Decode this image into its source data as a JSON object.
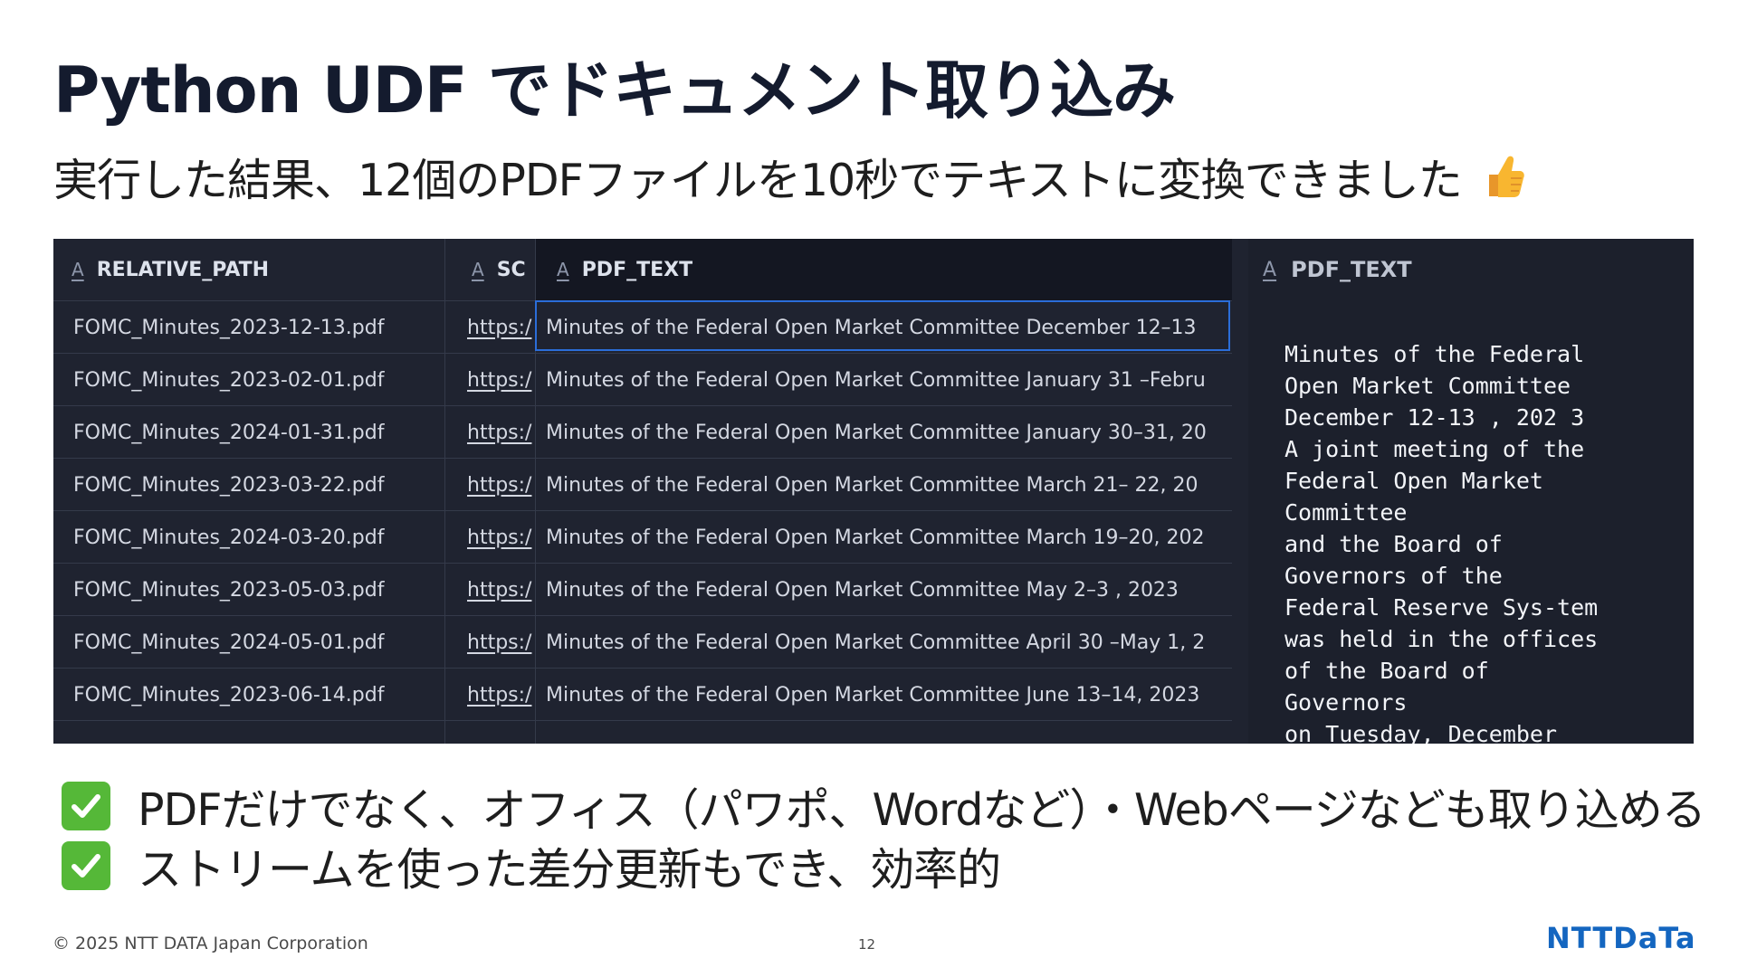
{
  "slide": {
    "title": "Python UDF でドキュメント取り込み",
    "subtitle": "実行した結果、12個のPDFファイルを10秒でテキストに変換できました"
  },
  "grid": {
    "columns": [
      {
        "label": "RELATIVE_PATH",
        "type_icon": "A"
      },
      {
        "label": "SC",
        "type_icon": "A"
      },
      {
        "label": "PDF_TEXT",
        "type_icon": "A"
      }
    ],
    "rows": [
      {
        "path": "FOMC_Minutes_2023-12-13.pdf",
        "url": "https:/",
        "text": " Minutes of the Federal Open Market Committee  December 12–13"
      },
      {
        "path": "FOMC_Minutes_2023-02-01.pdf",
        "url": "https:/",
        "text": "Minutes of the Federal Open Market Committee  January 31 –Febru"
      },
      {
        "path": "FOMC_Minutes_2024-01-31.pdf",
        "url": "https:/",
        "text": "Minutes of the Federal Open Market Committee  January  30–31, 20"
      },
      {
        "path": "FOMC_Minutes_2023-03-22.pdf",
        "url": "https:/",
        "text": " Minutes of the Federal Open Market Committee  March 21– 22, 20"
      },
      {
        "path": "FOMC_Minutes_2024-03-20.pdf",
        "url": "https:/",
        "text": "Minutes of the Federal Open Market Committee  March 19–20, 202"
      },
      {
        "path": "FOMC_Minutes_2023-05-03.pdf",
        "url": "https:/",
        "text": "Minutes of the Federal Open Market Committee   May 2–3 , 2023"
      },
      {
        "path": "FOMC_Minutes_2024-05-01.pdf",
        "url": "https:/",
        "text": "Minutes of the Federal Open Market Committee   April 30 –May 1, 2"
      },
      {
        "path": "FOMC_Minutes_2023-06-14.pdf",
        "url": "https:/",
        "text": " Minutes of the Federal Open Market Committee  June 13–14, 2023"
      }
    ]
  },
  "detail": {
    "header": "PDF_TEXT",
    "type_icon": "A",
    "text": "Minutes of the Federal\nOpen Market Committee\nDecember 12-13 , 202 3\nA joint meeting of the\nFederal Open Market\nCommittee\nand the Board of\nGovernors of the\nFederal Reserve Sys-tem\nwas held in the offices\nof the Board of\nGovernors\non Tuesday, December"
  },
  "bullets": [
    "PDFだけでなく、オフィス（パワポ、Wordなど）・Webページなども取り込める",
    "ストリームを使った差分更新もでき、効率的"
  ],
  "footer": {
    "copyright": "© 2025 NTT DATA Japan Corporation",
    "page_number": "12",
    "logo": "NTTDaTa"
  },
  "colors": {
    "check": "#55b838",
    "logo": "#1466c0",
    "grid_bg": "#1f2330",
    "selection": "#2b6dd8"
  }
}
